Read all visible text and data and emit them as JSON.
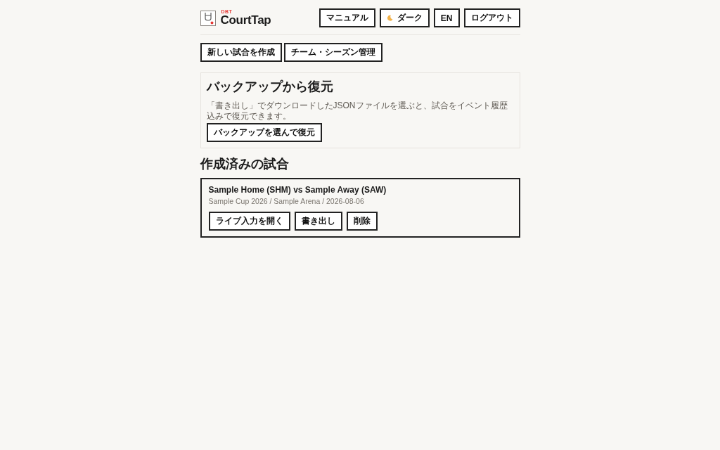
{
  "header": {
    "logo": {
      "badge": "DBT",
      "name": "CourtTap"
    },
    "buttons": [
      {
        "label": "マニュアル",
        "kind": "plain"
      },
      {
        "label": "ダーク",
        "kind": "theme"
      },
      {
        "label": "EN",
        "kind": "plain"
      },
      {
        "label": "ログアウト",
        "kind": "plain"
      }
    ]
  },
  "actions": [
    {
      "label": "新しい試合を作成"
    },
    {
      "label": "チーム・シーズン管理"
    }
  ],
  "backup": {
    "title": "バックアップから復元",
    "description": "「書き出し」でダウンロードしたJSONファイルを選ぶと、試合をイベント履歴込みで復元できます。",
    "button": "バックアップを選んで復元"
  },
  "matches": {
    "title": "作成済みの試合",
    "items": [
      {
        "title": "Sample Home (SHM) vs Sample Away (SAW)",
        "meta": "Sample Cup 2026 / Sample Arena / 2026-08-06",
        "buttons": [
          "ライブ入力を開く",
          "書き出し",
          "削除"
        ]
      }
    ]
  }
}
